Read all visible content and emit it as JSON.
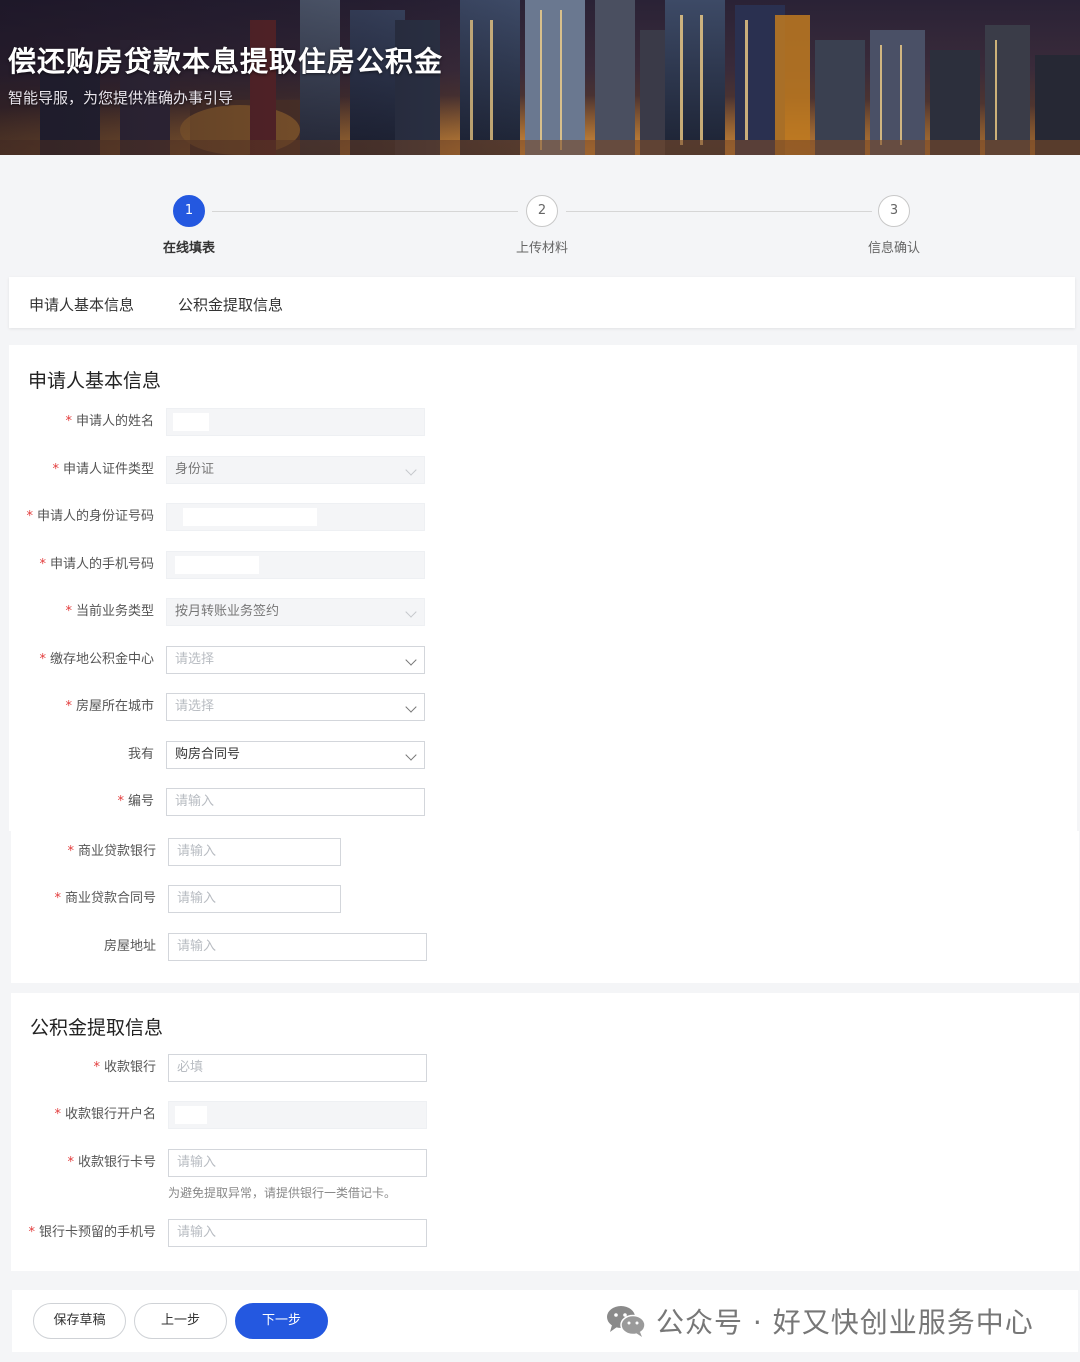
{
  "banner": {
    "title": "偿还购房贷款本息提取住房公积金",
    "subtitle": "智能导服，为您提供准确办事引导"
  },
  "steps": [
    {
      "num": "1",
      "label": "在线填表",
      "active": true
    },
    {
      "num": "2",
      "label": "上传材料",
      "active": false
    },
    {
      "num": "3",
      "label": "信息确认",
      "active": false
    }
  ],
  "tabs": [
    "申请人基本信息",
    "公积金提取信息"
  ],
  "applicant": {
    "title": "申请人基本信息",
    "fields": {
      "name": {
        "label": "申请人的姓名",
        "required": true,
        "value": ""
      },
      "id_type": {
        "label": "申请人证件类型",
        "required": true,
        "value": "身份证"
      },
      "id_number": {
        "label": "申请人的身份证号码",
        "required": true,
        "value": ""
      },
      "phone": {
        "label": "申请人的手机号码",
        "required": true,
        "value": ""
      },
      "biz_type": {
        "label": "当前业务类型",
        "required": true,
        "value": "按月转账业务签约"
      },
      "center": {
        "label": "缴存地公积金中心",
        "required": true,
        "placeholder": "请选择"
      },
      "city": {
        "label": "房屋所在城市",
        "required": true,
        "placeholder": "请选择"
      },
      "have": {
        "label": "我有",
        "required": false,
        "value": "购房合同号"
      },
      "number": {
        "label": "编号",
        "required": true,
        "placeholder": "请输入"
      },
      "loan_bank": {
        "label": "商业贷款银行",
        "required": true,
        "placeholder": "请输入"
      },
      "loan_contract": {
        "label": "商业贷款合同号",
        "required": true,
        "placeholder": "请输入"
      },
      "address": {
        "label": "房屋地址",
        "required": false,
        "placeholder": "请输入"
      }
    }
  },
  "withdraw": {
    "title": "公积金提取信息",
    "fields": {
      "bank": {
        "label": "收款银行",
        "required": true,
        "placeholder": "必填"
      },
      "account_name": {
        "label": "收款银行开户名",
        "required": true,
        "value": ""
      },
      "card_no": {
        "label": "收款银行卡号",
        "required": true,
        "placeholder": "请输入",
        "hint": "为避免提取异常，请提供银行一类借记卡。"
      },
      "reserved_phone": {
        "label": "银行卡预留的手机号",
        "required": true,
        "placeholder": "请输入"
      }
    }
  },
  "footer": {
    "save": "保存草稿",
    "prev": "上一步",
    "next": "下一步",
    "watermark": "公众号 · 好又快创业服务中心"
  },
  "colors": {
    "primary": "#2458e0",
    "required": "#e23a3a"
  }
}
